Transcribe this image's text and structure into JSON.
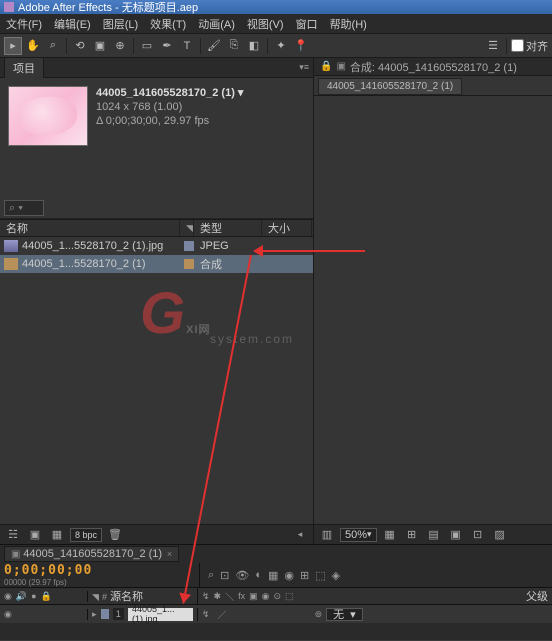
{
  "window": {
    "title": "Adobe After Effects - 无标题项目.aep"
  },
  "menu": {
    "file": "文件(F)",
    "edit": "编辑(E)",
    "comp": "图层(L)",
    "effect": "效果(T)",
    "anim": "动画(A)",
    "view": "视图(V)",
    "window": "窗口",
    "help": "帮助(H)"
  },
  "toolbar_right": {
    "align": "对齐"
  },
  "project": {
    "tab": "项目",
    "preview_title": "44005_141605528170_2 (1) ▾",
    "preview_res": "1024 x 768 (1.00)",
    "preview_dur": "Δ 0;00;30;00, 29.97 fps",
    "search_placeholder": "⌕ ▾",
    "cols": {
      "name": "名称",
      "type": "类型",
      "size": "大小"
    },
    "items": [
      {
        "name": "44005_1...5528170_2 (1).jpg",
        "type": "JPEG",
        "swatch": "#7a86a2"
      },
      {
        "name": "44005_1...5528170_2 (1)",
        "type": "合成",
        "swatch": "#b8905a"
      }
    ],
    "footer": {
      "bpc": "8 bpc"
    }
  },
  "comp_panel": {
    "label": "合成: 44005_141605528170_2 (1)",
    "tab": "44005_141605528170_2 (1)",
    "zoom": "50%"
  },
  "timeline": {
    "tab": "44005_141605528170_2 (1)",
    "timecode": "0;00;00;00",
    "frames": "00000 (29.97 fps)",
    "cols": {
      "source": "源名称",
      "parent": "父级"
    },
    "layer": {
      "index": "1",
      "name": "44005_1... (1).jpg",
      "parent_value": "无"
    }
  },
  "watermark": {
    "main": "XI网",
    "g": "G",
    "sub": "system.com"
  }
}
